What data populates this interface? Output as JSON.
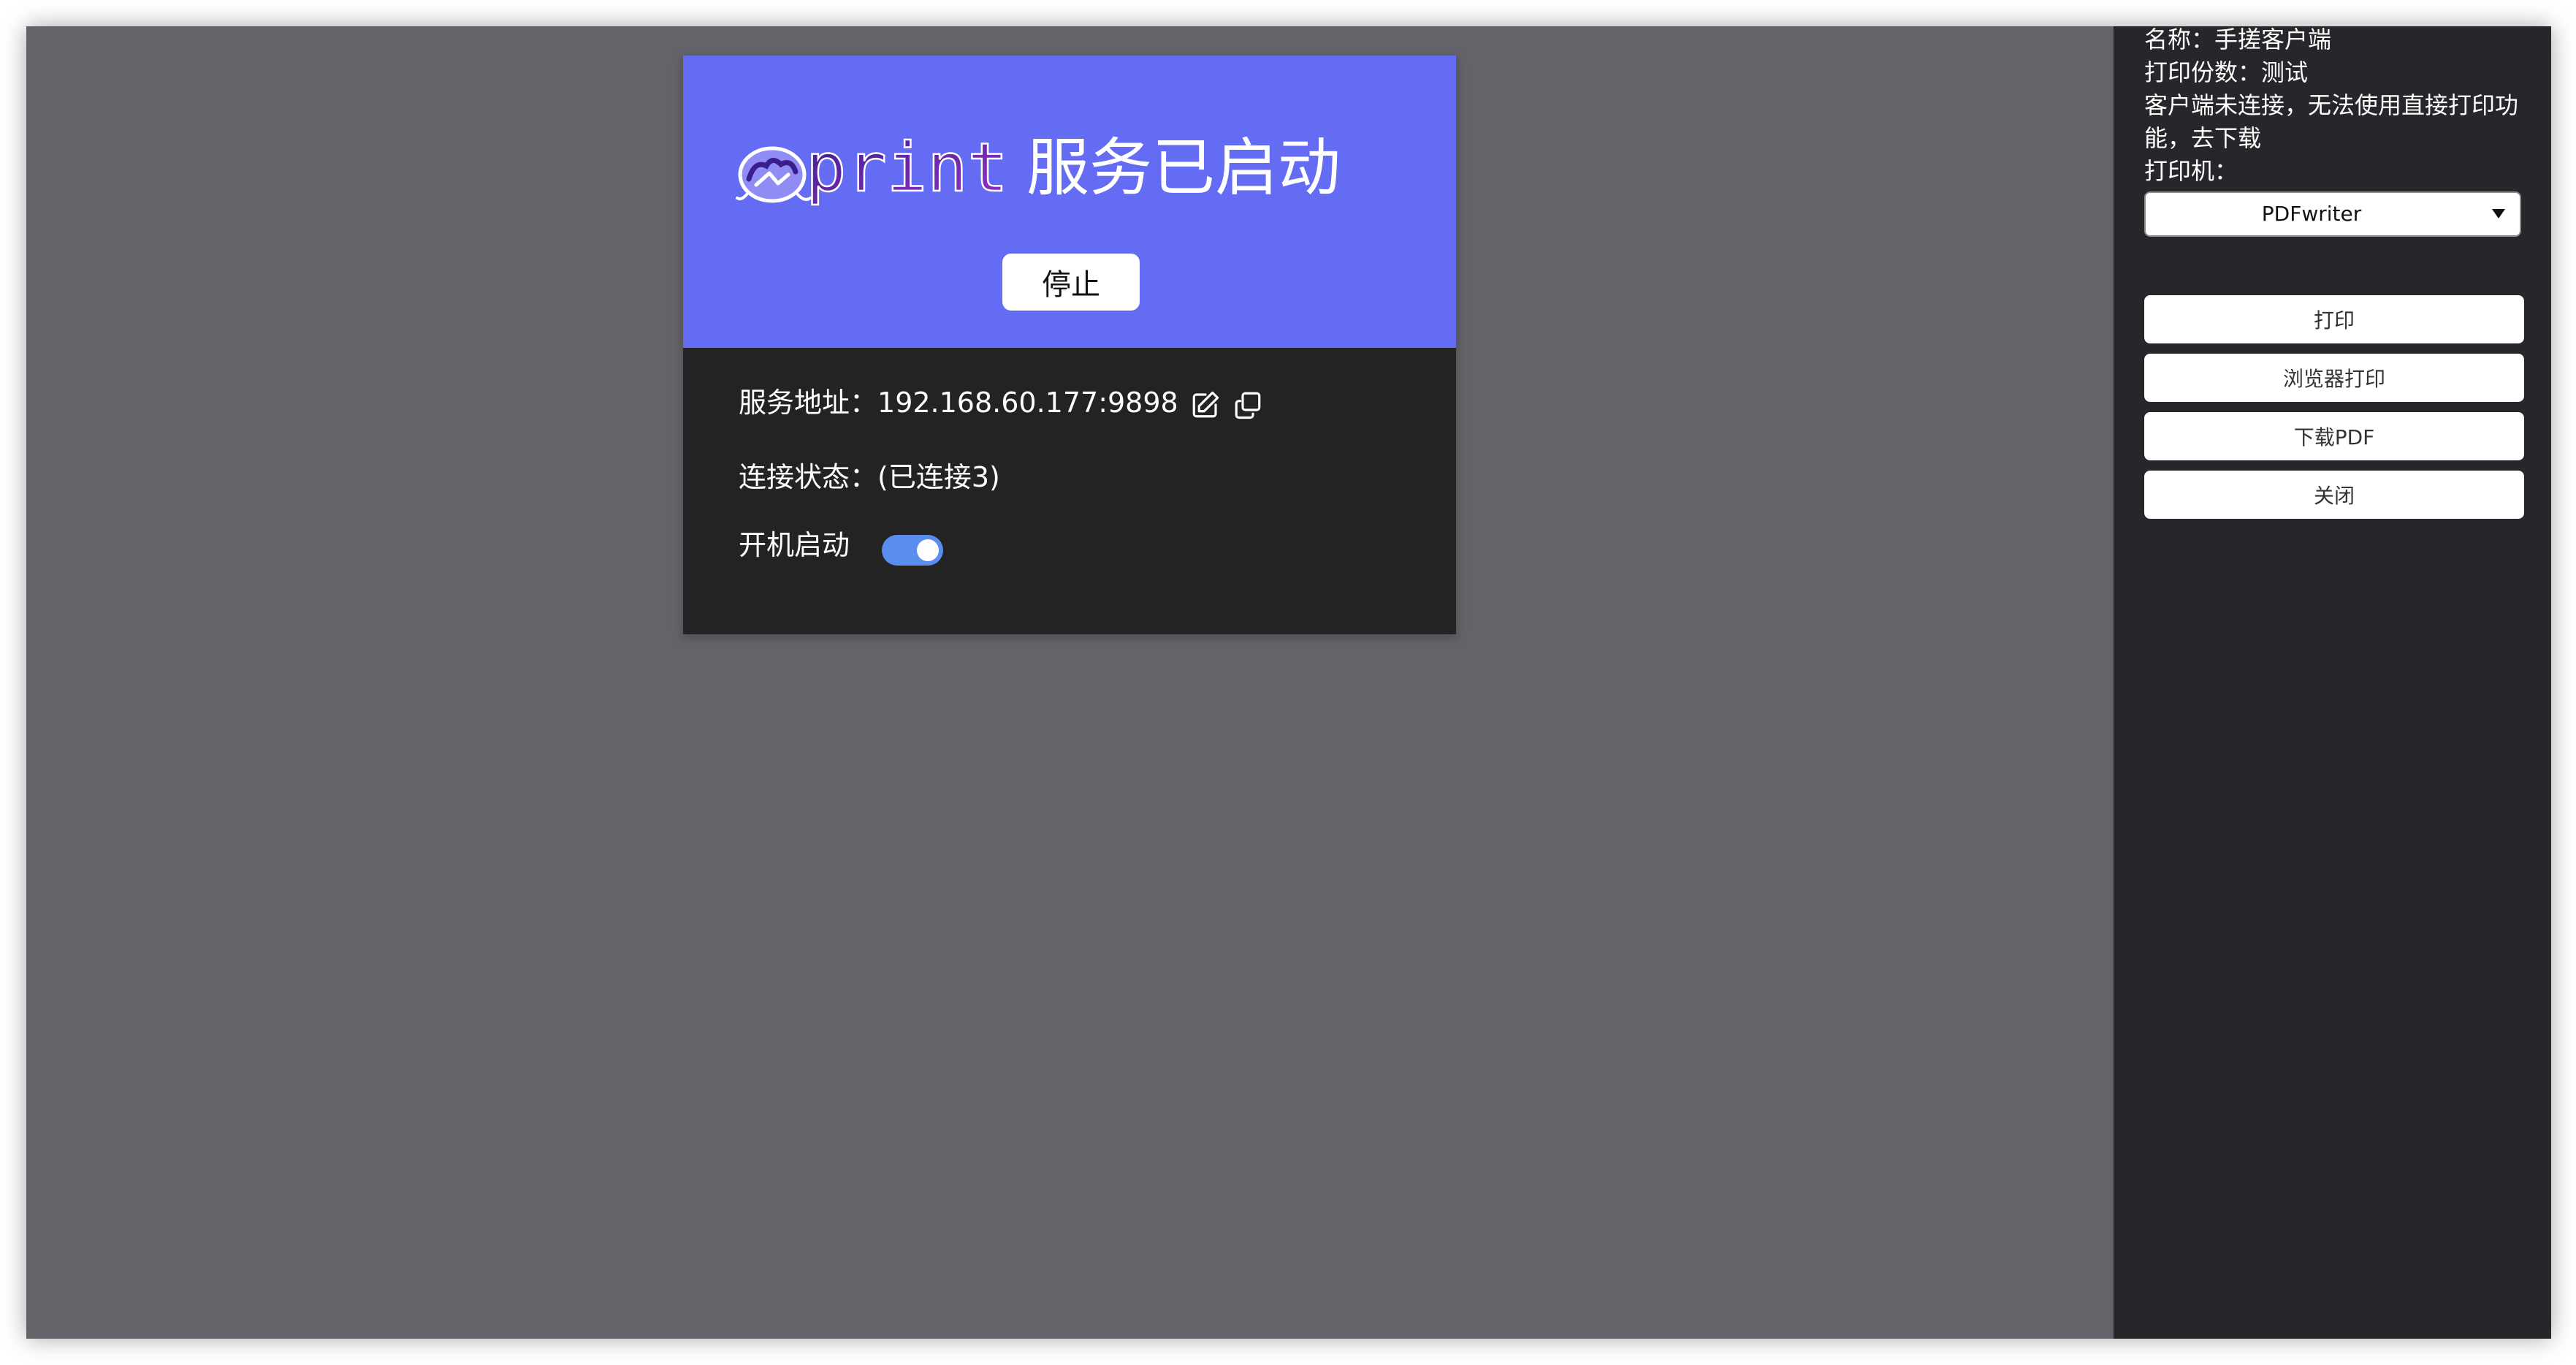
{
  "service_card": {
    "logo_text": "eprint",
    "headline": "服务已启动",
    "stop_button": "停止",
    "address_label": "服务地址：",
    "address_value": "192.168.60.177:9898",
    "status_label": "连接状态：",
    "status_value": "(已连接3)",
    "autostart_label": "开机启动",
    "autostart_enabled": true,
    "icons": {
      "edit": "edit-icon",
      "copy": "copy-icon"
    }
  },
  "sidebar": {
    "name_line": "名称：手搓客户端",
    "copies_line": "打印份数：测试",
    "notice_line": "客户端未连接，无法使用直接打印功能，去下载",
    "printer_label": "打印机：",
    "printer_selected": "PDFwriter",
    "buttons": {
      "print": "打印",
      "browser_print": "浏览器打印",
      "download_pdf": "下载PDF",
      "close": "关闭"
    }
  },
  "colors": {
    "main_background": "#636469",
    "card_header": "#646cf3",
    "card_body": "#232323",
    "sidebar_background": "#26272b",
    "toggle_on": "#5b8def"
  }
}
